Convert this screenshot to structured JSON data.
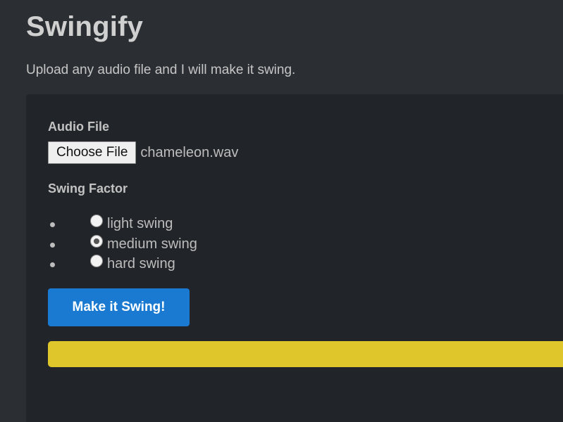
{
  "header": {
    "title": "Swingify",
    "subtitle": "Upload any audio file and I will make it swing."
  },
  "form": {
    "audio_label": "Audio File",
    "file_button_label": "Choose File",
    "file_name": "chameleon.wav",
    "swing_label": "Swing Factor",
    "options": [
      {
        "label": "light swing",
        "checked": false
      },
      {
        "label": "medium swing",
        "checked": true
      },
      {
        "label": "hard swing",
        "checked": false
      }
    ],
    "submit_label": "Make it Swing!",
    "progress_percent": 100
  },
  "colors": {
    "background": "#2b2e33",
    "panel": "#212428",
    "button": "#1a7ad1",
    "progress": "#dfc72b"
  }
}
